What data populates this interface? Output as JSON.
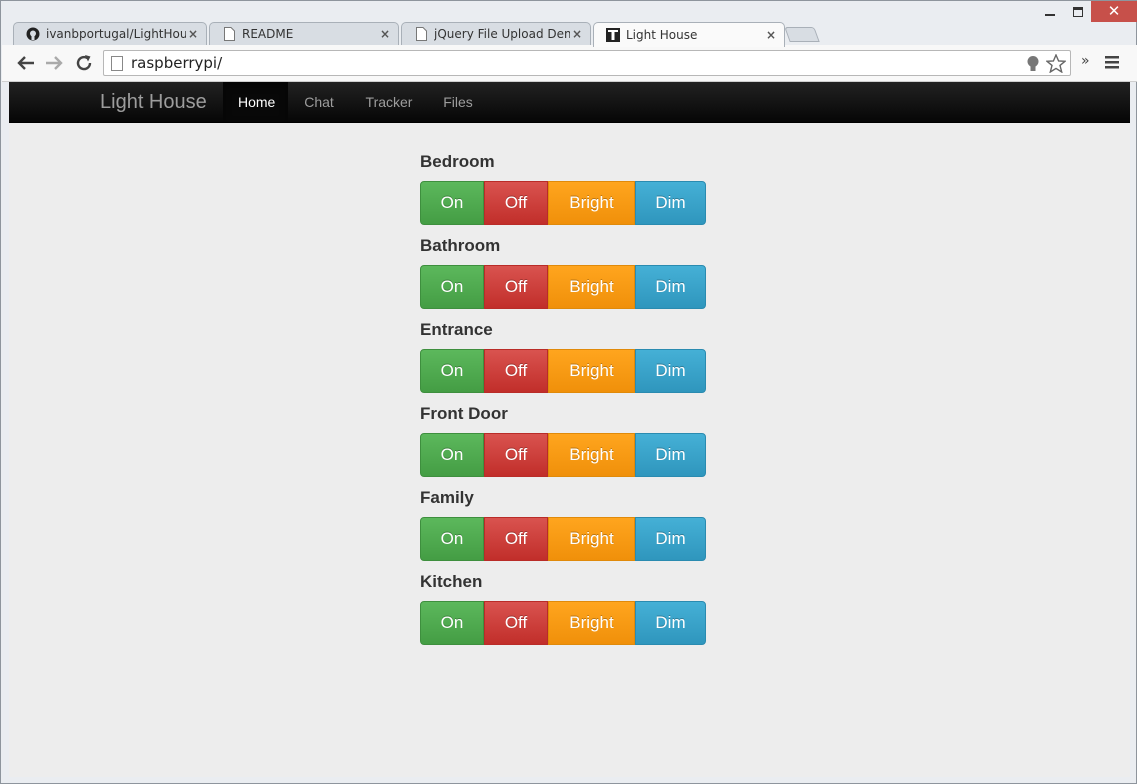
{
  "browser": {
    "tabs": [
      {
        "title": "ivanbportugal/LightHouse",
        "icon": "github-icon"
      },
      {
        "title": "README",
        "icon": "document-icon"
      },
      {
        "title": "jQuery File Upload Demo",
        "icon": "document-icon"
      },
      {
        "title": "Light House",
        "icon": "lighthouse-icon"
      }
    ],
    "active_tab": 3,
    "url": "raspberrypi/",
    "close_glyph": "×",
    "extensions_glyph": "»"
  },
  "navbar": {
    "brand": "Light House",
    "items": [
      "Home",
      "Chat",
      "Tracker",
      "Files"
    ],
    "active": "Home"
  },
  "rooms": [
    {
      "name": "Bedroom"
    },
    {
      "name": "Bathroom"
    },
    {
      "name": "Entrance"
    },
    {
      "name": "Front Door"
    },
    {
      "name": "Family"
    },
    {
      "name": "Kitchen"
    }
  ],
  "buttons": {
    "on": "On",
    "off": "Off",
    "bright": "Bright",
    "dim": "Dim"
  },
  "colors": {
    "on": "#5cb85c",
    "off": "#d9534f",
    "bright": "#f89c17",
    "dim": "#39a3cc",
    "navbar": "#111111",
    "page_background": "#ededed"
  }
}
